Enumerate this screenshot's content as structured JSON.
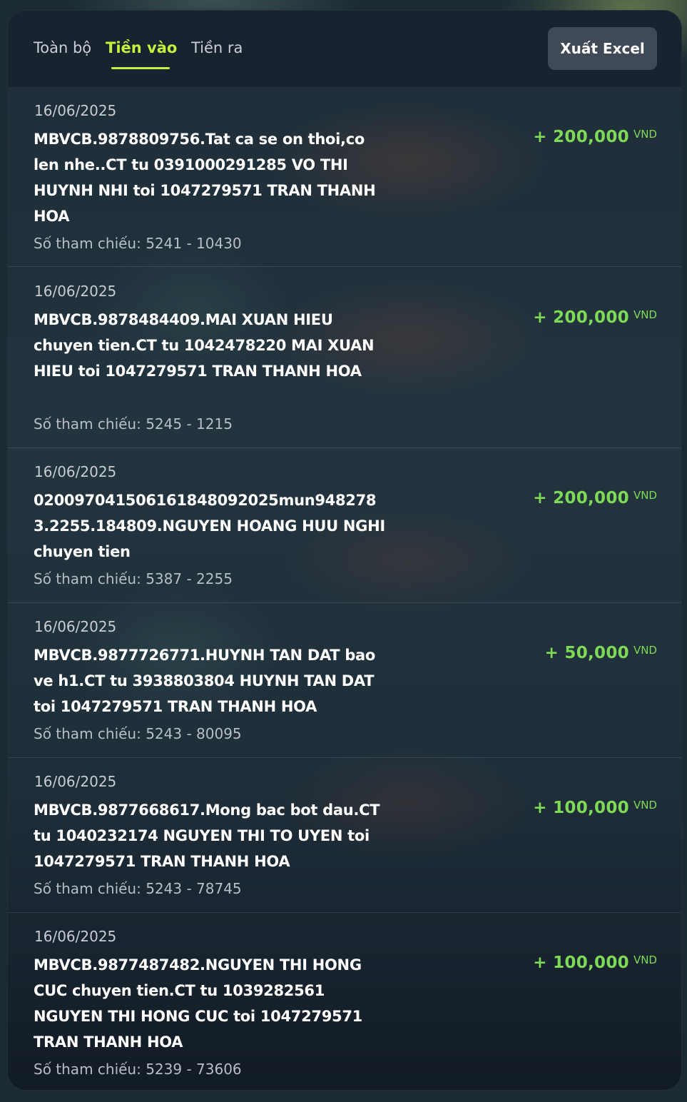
{
  "tabs": [
    {
      "label": "Toàn bộ"
    },
    {
      "label": "Tiền vào"
    },
    {
      "label": "Tiền ra"
    }
  ],
  "active_tab": "Tiền vào",
  "export_label": "Xuất Excel",
  "ref_label": "Số tham chiếu:",
  "currency": "VND",
  "colors": {
    "accent": "#c7ef3e",
    "amount": "#7ed957",
    "button_bg": "#404a57"
  },
  "transactions": [
    {
      "date": "16/06/2025",
      "description": "MBVCB.9878809756.Tat ca se on thoi,co len nhe..CT tu 0391000291285 VO THI HUYNH NHI toi 1047279571 TRAN THANH HOA",
      "reference": "Số tham chiếu: 5241 - 10430",
      "amount": "+ 200,000",
      "currency": "VND"
    },
    {
      "date": "16/06/2025",
      "description": "MBVCB.9878484409.MAI XUAN HIEU chuyen tien.CT tu 1042478220 MAI XUAN HIEU toi 1047279571 TRAN THANH HOA",
      "reference": "Số tham chiếu: 5245 - 1215",
      "amount": "+ 200,000",
      "currency": "VND"
    },
    {
      "date": "16/06/2025",
      "description": "020097041506161848092025mun9482783.2255.184809.NGUYEN HOANG HUU NGHI chuyen tien",
      "reference": "Số tham chiếu: 5387 - 2255",
      "amount": "+ 200,000",
      "currency": "VND"
    },
    {
      "date": "16/06/2025",
      "description": "MBVCB.9877726771.HUYNH TAN DAT bao ve h1.CT tu 3938803804 HUYNH TAN DAT toi 1047279571 TRAN THANH HOA",
      "reference": "Số tham chiếu: 5243 - 80095",
      "amount": "+ 50,000",
      "currency": "VND"
    },
    {
      "date": "16/06/2025",
      "description": "MBVCB.9877668617.Mong bac bot dau.CT tu 1040232174 NGUYEN THI TO UYEN toi 1047279571 TRAN THANH HOA",
      "reference": "Số tham chiếu: 5243 - 78745",
      "amount": "+ 100,000",
      "currency": "VND"
    },
    {
      "date": "16/06/2025",
      "description": "MBVCB.9877487482.NGUYEN THI HONG CUC chuyen tien.CT tu 1039282561 NGUYEN THI HONG CUC toi 1047279571 TRAN THANH HOA",
      "reference": "Số tham chiếu: 5239 - 73606",
      "amount": "+ 100,000",
      "currency": "VND"
    }
  ]
}
